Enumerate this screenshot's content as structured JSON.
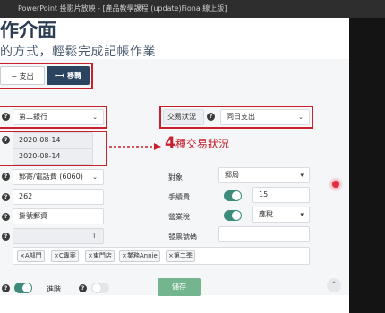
{
  "window": {
    "title": "PowerPoint 投影片放映 - [產品教學課程 (update)Fiona 線上版]"
  },
  "slide": {
    "heading": "作介面",
    "subheading": "的方式，輕鬆完成記帳作業"
  },
  "mode": {
    "expense_label": "支出",
    "transfer_label": "移轉"
  },
  "transfer": {
    "from_account": "第二銀行",
    "to_label": "交易狀況",
    "to_value": "同日支出",
    "date1": "2020-08-14",
    "date2": "2020-08-14"
  },
  "annotation": {
    "number": "4",
    "text": "種交易狀況"
  },
  "form": {
    "category": "郵寄/電話費 (6060)",
    "amount": "262",
    "memo": "掛號郵資",
    "payee_label": "對象",
    "payee_value": "郵局",
    "fee_label": "手續費",
    "fee_value": "15",
    "tax_label": "營業稅",
    "tax_value": "應稅",
    "invoice_label": "發票號碼",
    "invoice_value": ""
  },
  "tags": [
    "A部門",
    "C專案",
    "東門店",
    "業務Annie",
    "第二季"
  ],
  "footer": {
    "advanced_label": "進階",
    "save_label": "儲存"
  },
  "colors": {
    "accent": "#2b4560",
    "annotation": "#c8202c",
    "toggle_on": "#3d8b7a",
    "save": "#73b58f"
  }
}
